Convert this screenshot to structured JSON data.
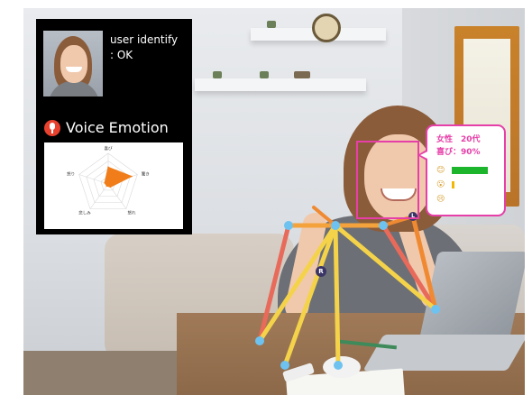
{
  "panel": {
    "user_identify_label": "user identify",
    "user_identify_status": ": OK",
    "voice_emotion_title": "Voice Emotion",
    "mic_icon": "microphone-icon",
    "accent_color": "#e8412e"
  },
  "chart_data": {
    "type": "radar",
    "title": "",
    "axes": [
      "喜び",
      "驚き",
      "怒れ",
      "悲しみ",
      "怒り"
    ],
    "series": [
      {
        "values": [
          0.55,
          0.8,
          0.12,
          0.08,
          0.12
        ]
      }
    ],
    "range": [
      0,
      1
    ],
    "fill_color": "#f07d1a"
  },
  "callout": {
    "gender_age": "女性　20代",
    "emotion_value": "喜び：90%",
    "border_color": "#e63fa8",
    "emotions": [
      {
        "icon": "happy-face-icon",
        "glyph": "😊",
        "value": 0.9,
        "color": "#1db52c"
      },
      {
        "icon": "surprised-face-icon",
        "glyph": "😮",
        "value": 0.07,
        "color": "#f2b705"
      },
      {
        "icon": "sad-face-icon",
        "glyph": "😢",
        "value": 0.0,
        "color": "#f2b705"
      }
    ]
  },
  "pose_markers": {
    "left": "L",
    "right": "R"
  },
  "colors": {
    "skeleton_shoulder": "#f3a23c",
    "skeleton_left_arm": "#f08a32",
    "skeleton_right_limb": "#e86a5a",
    "skeleton_torso": "#f4d34a",
    "joint": "#6ec2f0"
  }
}
